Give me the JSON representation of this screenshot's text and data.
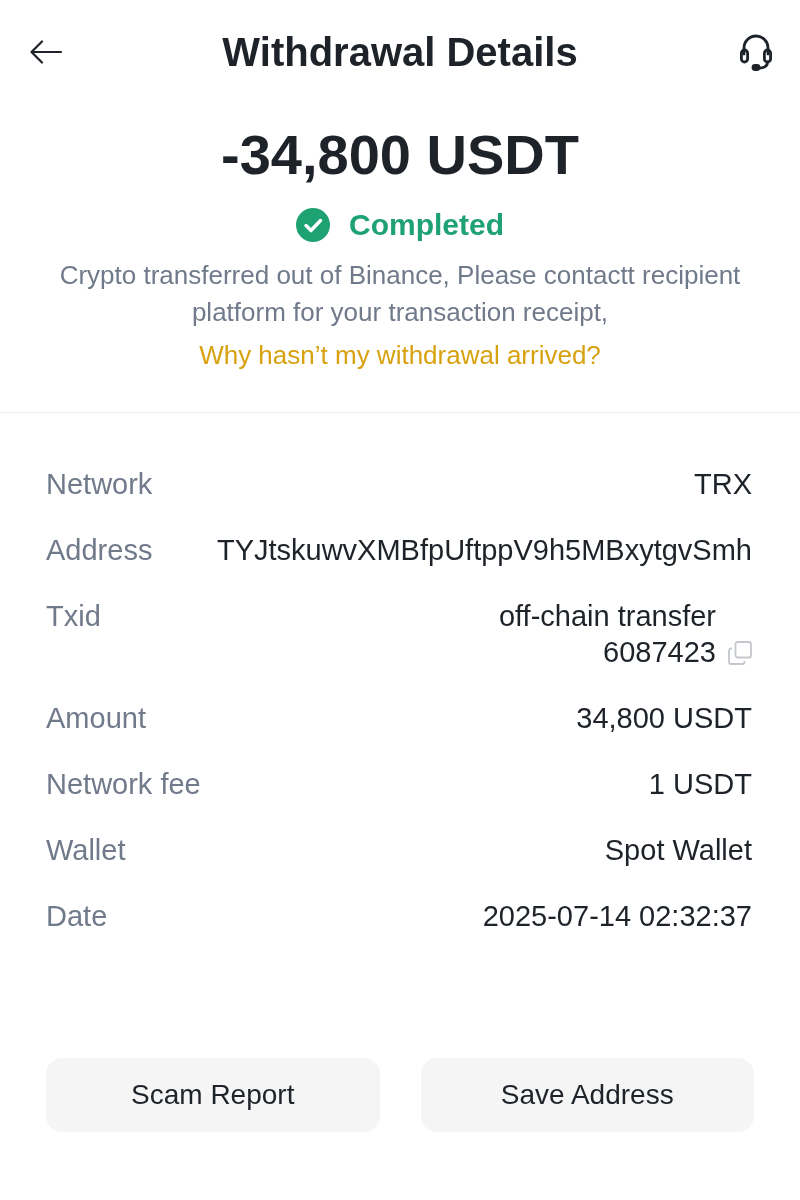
{
  "header": {
    "title": "Withdrawal Details"
  },
  "amount": "-34,800 USDT",
  "status": {
    "kind": "completed",
    "label": "Completed"
  },
  "notice": "Crypto transferred out of Binance, Please contactt recipient platform for your transaction receipt,",
  "help_link": "Why hasn’t my withdrawal arrived?",
  "details": [
    {
      "label": "Network",
      "value": "TRX",
      "copyable": false
    },
    {
      "label": "Address",
      "value": "TYJtskuwvXMBfpUftppV9h5MBxytgvSmh",
      "copyable": false
    },
    {
      "label": "Txid",
      "value": "off-chain transfer 6087423",
      "copyable": true
    },
    {
      "label": "Amount",
      "value": "34,800 USDT",
      "copyable": false
    },
    {
      "label": "Network fee",
      "value": "1 USDT",
      "copyable": false
    },
    {
      "label": "Wallet",
      "value": "Spot Wallet",
      "copyable": false
    },
    {
      "label": "Date",
      "value": "2025-07-14 02:32:37",
      "copyable": false
    }
  ],
  "buttons": [
    "Scam Report",
    "Save Address"
  ]
}
